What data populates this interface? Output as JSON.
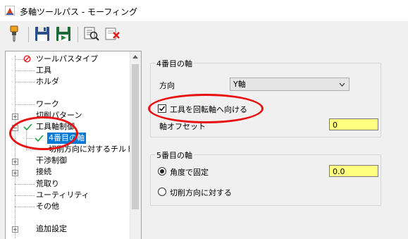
{
  "window": {
    "title": "多軸ツールパス - モーフィング"
  },
  "toolbar": {
    "buttons": [
      {
        "icon": "tool-icon"
      },
      {
        "icon": "save-icon"
      },
      {
        "icon": "save-and-run-icon"
      },
      {
        "icon": "preview-icon"
      },
      {
        "icon": "delete-icon"
      }
    ]
  },
  "tree": {
    "items": [
      {
        "label": "ツールパスタイプ",
        "icon": "invalid-icon"
      },
      {
        "label": "工具"
      },
      {
        "label": "ホルダ"
      },
      {
        "label": "ワーク"
      },
      {
        "label": "切削パターン"
      },
      {
        "label": "工具軸制御",
        "icon": "checkmark-icon"
      },
      {
        "label": "4番目の軸",
        "icon": "checkmark-icon",
        "selected": true
      },
      {
        "label": "切削方向に対するチルト"
      },
      {
        "label": "干渉制御"
      },
      {
        "label": "接続"
      },
      {
        "label": "荒取り"
      },
      {
        "label": "ユーティリティ"
      },
      {
        "label": "その他"
      },
      {
        "label": "追加設定"
      }
    ]
  },
  "axis4": {
    "group_title": "4番目の軸",
    "direction_label": "方向",
    "direction_value": "Y軸",
    "orient_tool_label": "工具を回転軸へ向ける",
    "orient_tool_checked": true,
    "offset_label": "軸オフセット",
    "offset_value": "0"
  },
  "axis5": {
    "group_title": "5番目の軸",
    "fixed_angle_label": "角度で固定",
    "fixed_angle_selected": true,
    "fixed_angle_value": "0.0",
    "relative_label": "切削方向に対する"
  },
  "colors": {
    "highlight": "#e81010",
    "selection": "#0078d7",
    "input_bg": "#ffff80"
  }
}
